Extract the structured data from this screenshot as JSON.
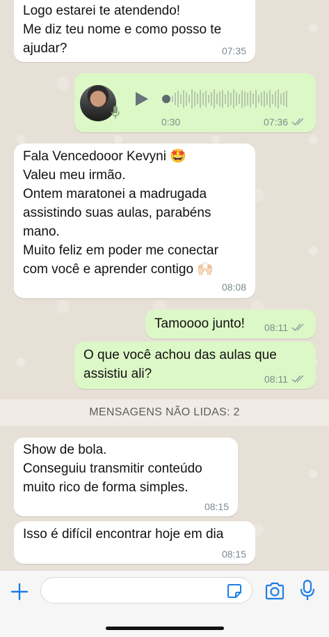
{
  "messages": [
    {
      "type": "text",
      "direction": "in",
      "text": "Logo estarei te atendendo!\nMe diz teu nome e como posso te\najudar?",
      "time": "07:35"
    },
    {
      "type": "voice",
      "direction": "out",
      "duration": "0:30",
      "time": "07:36",
      "status": "read"
    },
    {
      "type": "text",
      "direction": "in",
      "text": "Fala Vencedooor Kevyni 🤩\nValeu meu irmão.\nOntem maratonei a madrugada\nassistindo suas aulas, parabéns\nmano.\nMuito feliz em poder me conectar\ncom você e aprender contigo 🙌🏻",
      "time": "08:08"
    },
    {
      "type": "text",
      "direction": "out",
      "text": "Tamoooo junto!",
      "time": "08:11",
      "status": "read"
    },
    {
      "type": "text",
      "direction": "out",
      "text": "O que você achou das aulas que\nassistiu ali?",
      "time": "08:11",
      "status": "read"
    },
    {
      "type": "text",
      "direction": "in",
      "text": "Show de bola.\nConseguiu transmitir conteúdo\nmuito rico de forma simples.",
      "time": "08:15"
    },
    {
      "type": "text",
      "direction": "in",
      "text": "Isso é difícil encontrar hoje em dia",
      "time": "08:15"
    }
  ],
  "unread_banner": "MENSAGENS NÃO LIDAS: 2",
  "composer": {
    "placeholder": "",
    "icons": [
      "plus-icon",
      "sticker-icon",
      "camera-icon",
      "microphone-icon"
    ],
    "accent": "#1c7ee6"
  },
  "colors": {
    "incoming_bubble": "#ffffff",
    "outgoing_bubble": "#dcf8c6",
    "chat_background": "#e7e0d7"
  }
}
